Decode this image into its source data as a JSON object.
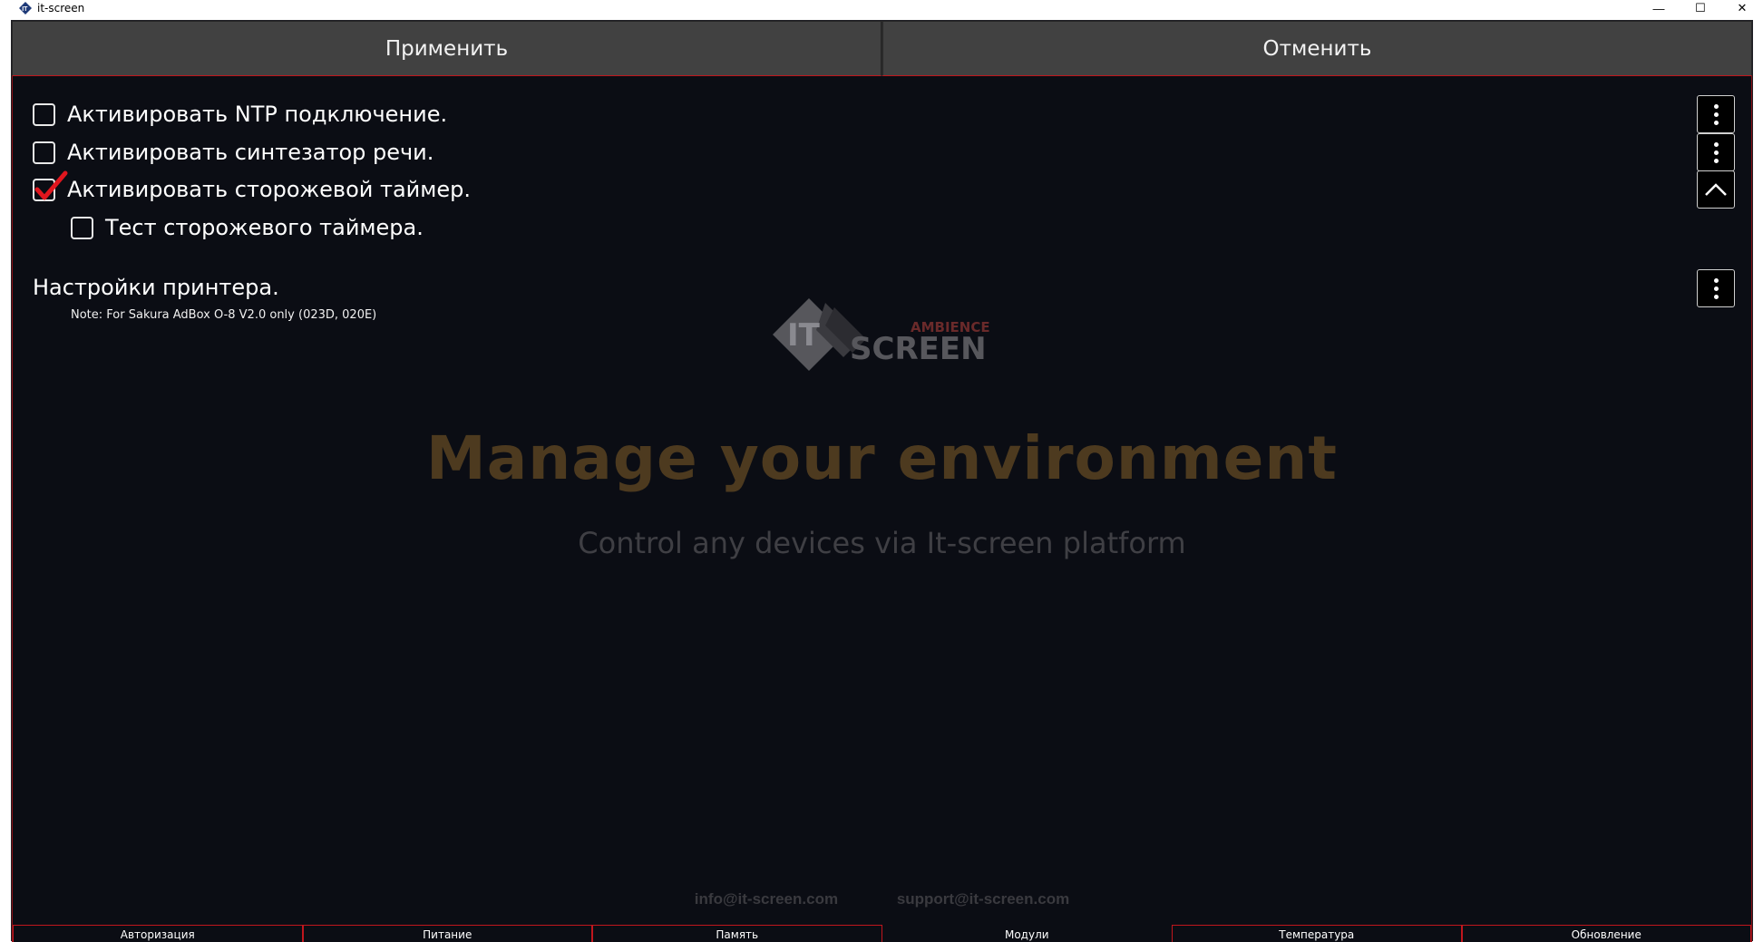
{
  "window": {
    "title": "it-screen",
    "controls": {
      "minimize": "—",
      "maximize": "☐",
      "close": "✕"
    }
  },
  "actions": {
    "apply_label": "Применить",
    "cancel_label": "Отменить"
  },
  "options": [
    {
      "label": "Активировать NTP подключение.",
      "checked": false
    },
    {
      "label": "Активировать синтезатор речи.",
      "checked": false
    },
    {
      "label": "Активировать сторожевой таймер.",
      "checked": true
    },
    {
      "label": "Тест сторожевого таймера.",
      "checked": false
    }
  ],
  "note": "Note: For Sakura AdBox O-8 V2.0 only (023D, 020E)",
  "printer_settings_label": "Настройки принтера.",
  "watermark": {
    "logo_it": "IT",
    "logo_ambience": "AMBIENCE",
    "logo_screen": "SCREEN",
    "headline": "Manage your environment",
    "subline": "Control any devices via It-screen platform",
    "email_info": "info@it-screen.com",
    "email_support": "support@it-screen.com"
  },
  "tabs": [
    {
      "label": "Авторизация",
      "active": false
    },
    {
      "label": "Питание",
      "active": false
    },
    {
      "label": "Память",
      "active": false
    },
    {
      "label": "Модули",
      "active": true
    },
    {
      "label": "Температура",
      "active": false
    },
    {
      "label": "Обновление",
      "active": false
    }
  ],
  "colors": {
    "background": "#0b0d14",
    "accent_red": "#c0161d",
    "button_gray": "#414141",
    "headline_gold": "#4d3a1f"
  },
  "icons": {
    "app": "it-screen-logo-icon",
    "menu": "vertical-dots-icon",
    "collapse": "chevron-up-icon",
    "checkmark": "checkmark-icon"
  }
}
